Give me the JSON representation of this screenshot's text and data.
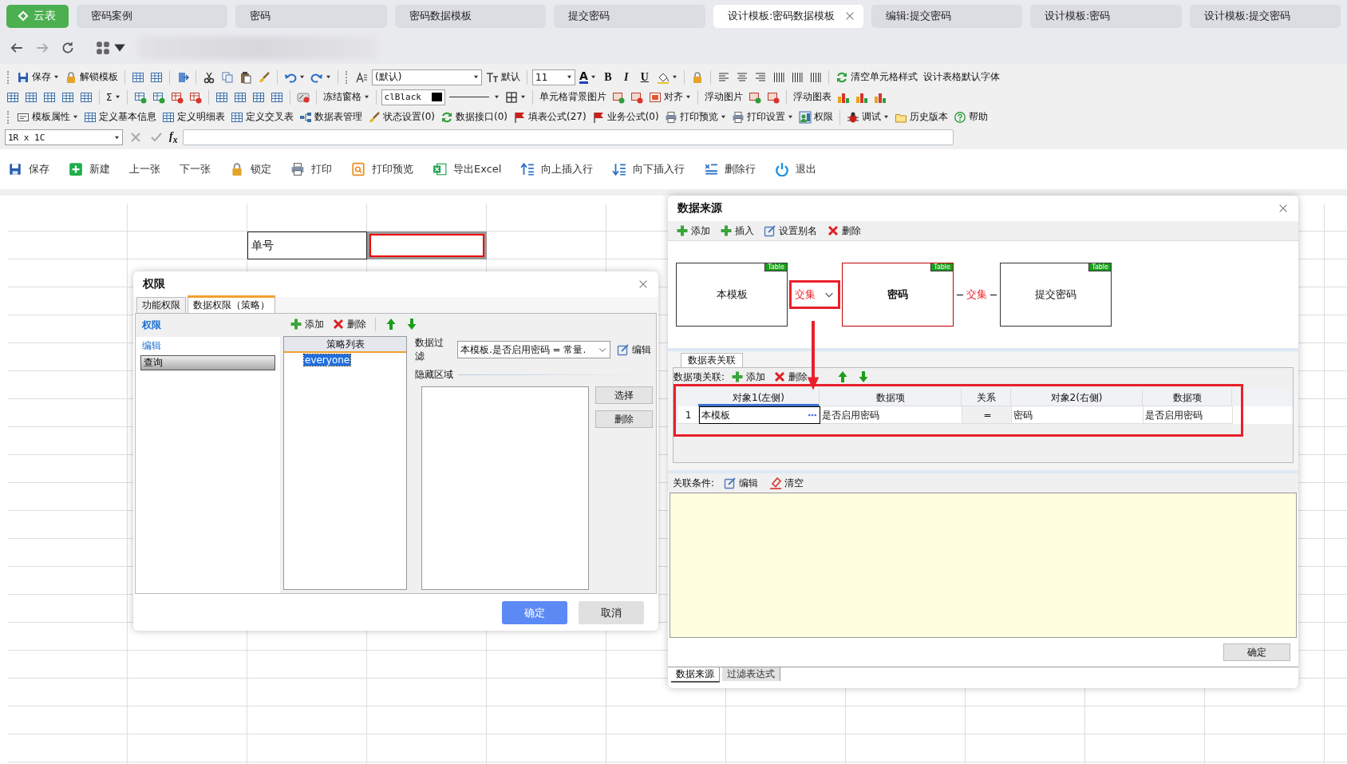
{
  "tabs": [
    {
      "label": "云表",
      "kind": "logo",
      "selected": false
    },
    {
      "label": "密码案例",
      "kind": "page",
      "selected": false
    },
    {
      "label": "密码",
      "kind": "page",
      "selected": false
    },
    {
      "label": "密码数据模板",
      "kind": "page",
      "selected": false
    },
    {
      "label": "提交密码",
      "kind": "page",
      "selected": false
    },
    {
      "label": "设计模板:密码数据模板",
      "kind": "page",
      "selected": true
    },
    {
      "label": "编辑:提交密码",
      "kind": "page",
      "selected": false
    },
    {
      "label": "设计模板:密码",
      "kind": "page",
      "selected": false
    },
    {
      "label": "设计模板:提交密码",
      "kind": "page",
      "selected": false
    }
  ],
  "toolbar_rows": [
    [
      {
        "kind": "button",
        "label": "保存",
        "dropdown": true
      },
      {
        "kind": "button",
        "label": "解锁模板",
        "dropdown": false
      },
      {
        "kind": "combo",
        "value": "(默认)"
      },
      {
        "kind": "button",
        "label": "默认",
        "dropdown": false
      },
      {
        "kind": "combo",
        "value": "11"
      },
      {
        "kind": "font_color",
        "label": "A",
        "color": "#1f3fbf"
      },
      {
        "kind": "format",
        "label": "B"
      },
      {
        "kind": "format",
        "label": "I"
      },
      {
        "kind": "format",
        "label": "U"
      },
      {
        "kind": "button",
        "label": "清空单元格样式",
        "dropdown": false
      },
      {
        "kind": "button",
        "label": "设计表格默认字体",
        "dropdown": false
      }
    ],
    [
      {
        "kind": "button",
        "label": "Σ",
        "dropdown": true
      },
      {
        "kind": "button",
        "label": "冻结窗格",
        "dropdown": true
      },
      {
        "kind": "color_combo",
        "value": "clBlack"
      },
      {
        "kind": "button",
        "label": "单元格背景图片",
        "dropdown": false
      },
      {
        "kind": "button",
        "label": "对齐",
        "dropdown": true
      },
      {
        "kind": "button",
        "label": "浮动图片",
        "dropdown": false
      },
      {
        "kind": "button",
        "label": "浮动图表",
        "dropdown": false
      }
    ],
    [
      {
        "kind": "button",
        "label": "模板属性",
        "dropdown": true
      },
      {
        "kind": "button",
        "label": "定义基本信息",
        "dropdown": false
      },
      {
        "kind": "button",
        "label": "定义明细表",
        "dropdown": false
      },
      {
        "kind": "button",
        "label": "定义交叉表",
        "dropdown": false
      },
      {
        "kind": "button",
        "label": "数据表管理",
        "dropdown": false
      },
      {
        "kind": "button",
        "label": "状态设置(0)",
        "dropdown": false
      },
      {
        "kind": "button",
        "label": "数据接口(0)",
        "dropdown": false
      },
      {
        "kind": "button",
        "label": "填表公式(27)",
        "dropdown": false
      },
      {
        "kind": "button",
        "label": "业务公式(0)",
        "dropdown": false
      },
      {
        "kind": "button",
        "label": "打印预览",
        "dropdown": true
      },
      {
        "kind": "button",
        "label": "打印设置",
        "dropdown": true
      },
      {
        "kind": "button",
        "label": "权限",
        "dropdown": false
      },
      {
        "kind": "button",
        "label": "调试",
        "dropdown": true
      },
      {
        "kind": "button",
        "label": "历史版本",
        "dropdown": false
      },
      {
        "kind": "button",
        "label": "帮助",
        "dropdown": false
      }
    ]
  ],
  "formula_bar": {
    "cell_ref": "1R x 1C",
    "fx": "f$_{x}$"
  },
  "actions": [
    "保存",
    "新建",
    "上一张",
    "下一张",
    "锁定",
    "打印",
    "打印预览",
    "导出Excel",
    "向上插入行",
    "向下插入行",
    "删除行",
    "退出"
  ],
  "sheet": {
    "label_cell": {
      "text": "单号",
      "selected": false
    },
    "value_cell": {
      "selected": true
    }
  },
  "permission_dialog": {
    "title": "权限",
    "tabs": [
      {
        "label": "功能权限",
        "selected": false
      },
      {
        "label": "数据权限（策略）",
        "selected": true
      }
    ],
    "section": "权限",
    "rights": [
      {
        "label": "编辑",
        "selected": false
      },
      {
        "label": "查询",
        "selected": true
      }
    ],
    "toolbar": [
      {
        "label": "添加",
        "kind": "add"
      },
      {
        "label": "删除",
        "kind": "delete"
      }
    ],
    "policy_list": {
      "header": "策略列表",
      "items": [
        {
          "label": "everyone",
          "selected": true
        }
      ]
    },
    "filter_label": "数据过滤",
    "filter_value": "本模板.是否启用密码 = 常量.",
    "edit": "编辑",
    "hidden_area": "隐藏区域",
    "side_buttons": [
      "选择",
      "删除"
    ],
    "ok": "确定",
    "cancel": "取消"
  },
  "datasource_dialog": {
    "title": "数据来源",
    "toolbar": [
      {
        "label": "添加",
        "kind": "add"
      },
      {
        "label": "插入",
        "kind": "add"
      },
      {
        "label": "设置别名",
        "kind": "edit"
      },
      {
        "label": "删除",
        "kind": "delete"
      }
    ],
    "nodes": [
      {
        "name": "本模板",
        "badge": "Table",
        "selected": false
      },
      {
        "name": "密码",
        "badge": "Table",
        "selected": true
      },
      {
        "name": "提交密码",
        "badge": "Table",
        "selected": false
      }
    ],
    "joins": [
      {
        "label": "交集",
        "kind": "dropdown"
      },
      {
        "label": "交集",
        "kind": "line"
      }
    ],
    "relation_tab": "数据表关联",
    "items_label": "数据项关联:",
    "items_toolbar": [
      {
        "label": "添加",
        "kind": "add"
      },
      {
        "label": "删除",
        "kind": "delete"
      }
    ],
    "grid": {
      "columns": [
        "对象1(左侧)",
        "数据项",
        "关系",
        "对象2(右侧)",
        "数据项"
      ],
      "rows": [
        {
          "index": "1",
          "cells": [
            "本模板",
            "是否启用密码",
            "=",
            "密码",
            "是否启用密码"
          ]
        }
      ]
    },
    "condition_label": "关联条件:",
    "condition_tools": [
      {
        "label": "编辑",
        "kind": "edit"
      },
      {
        "label": "清空",
        "kind": "eraser"
      }
    ],
    "ok": "确定",
    "bottom_tabs": [
      {
        "label": "数据来源",
        "selected": true
      },
      {
        "label": "过滤表达式",
        "selected": false
      }
    ]
  }
}
